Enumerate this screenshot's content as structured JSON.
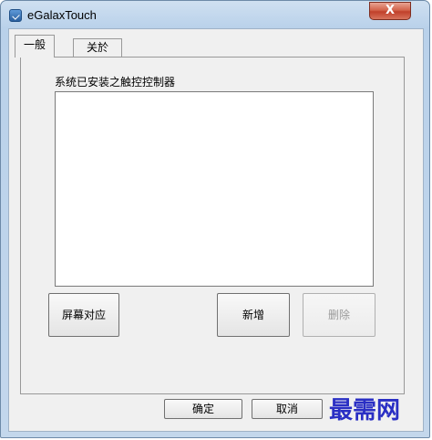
{
  "window": {
    "title": "eGalaxTouch",
    "close_glyph": "X"
  },
  "tabs": [
    {
      "label": "一般",
      "selected": true
    },
    {
      "label": "关於",
      "selected": false
    }
  ],
  "general": {
    "group_label": "系统已安装之触控控制器",
    "controllers": [],
    "buttons": {
      "screen_mapping": "屏幕对应",
      "add": "新增",
      "delete": "删除"
    }
  },
  "footer": {
    "ok_label": "确定",
    "cancel_label": "取消"
  },
  "watermark": "最需网",
  "colors": {
    "watermark": "#2a2fc4",
    "close_button": "#c0402a"
  }
}
